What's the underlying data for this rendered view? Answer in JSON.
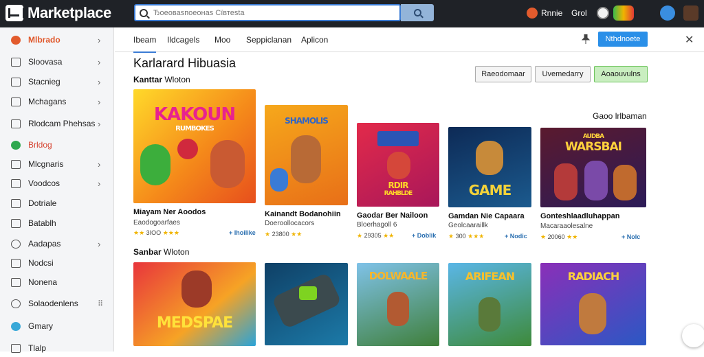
{
  "app": {
    "title": "Marketplace"
  },
  "search": {
    "placeholder": "Ђоеоваsпоеонаs Сївтеsta"
  },
  "topbar": {
    "user_name": "Rnnie",
    "mode": "Grol"
  },
  "sidebar": {
    "items": [
      {
        "label": "Mlbrado",
        "icon": "flame-icon",
        "chevron": true
      },
      {
        "label": "Sloovasa",
        "icon": "card-icon",
        "chevron": true
      },
      {
        "label": "Stacnieg",
        "icon": "grid-icon",
        "chevron": true
      },
      {
        "label": "Mchagans",
        "icon": "list-icon",
        "chevron": true
      },
      {
        "label": "Rlodcam Phehsas",
        "icon": "folder-icon",
        "chevron": true
      },
      {
        "label": "Brldog",
        "icon": "leaf-icon",
        "chevron": false
      },
      {
        "label": "Mlcgnaris",
        "icon": "table-icon",
        "chevron": true
      },
      {
        "label": "Voodcos",
        "icon": "tray-icon",
        "chevron": true
      },
      {
        "label": "Dotriale",
        "icon": "edit-icon",
        "chevron": false
      },
      {
        "label": "Batablh",
        "icon": "calendar-icon",
        "chevron": false
      },
      {
        "label": "Aadapas",
        "icon": "clock-icon",
        "chevron": true
      },
      {
        "label": "Nodcsi",
        "icon": "box-icon",
        "chevron": false
      },
      {
        "label": "Nonena",
        "icon": "image-icon",
        "chevron": false
      },
      {
        "label": "Solaodenlens",
        "icon": "settings-icon",
        "chevron": false
      },
      {
        "label": "Gmary",
        "icon": "globe-icon",
        "chevron": false
      },
      {
        "label": "Tlalp",
        "icon": "help-icon",
        "chevron": false
      }
    ]
  },
  "tabs": [
    {
      "label": "Ibeam",
      "active": true
    },
    {
      "label": "Ildcagels",
      "active": false
    },
    {
      "label": "Moo",
      "active": false
    },
    {
      "label": "Seppiclanan",
      "active": false
    },
    {
      "label": "Aplicon",
      "active": false
    }
  ],
  "toolbar": {
    "upgrade_label": "Nthdnoete"
  },
  "main": {
    "title": "Karlarard Hibuasia",
    "featured_heading_bold": "Kanttar",
    "featured_heading_rest": "Wloton",
    "filters": [
      "Raeodomaar",
      "Uvemedarry",
      "Aoaouvulns"
    ],
    "sort_label": "Gaoo lrlbaman",
    "second_heading_bold": "Sanbar",
    "second_heading_rest": "Wloton"
  },
  "featured_cards": [
    {
      "title": "Miayam Ner Aoodos",
      "sub": "Eaodogoarfaes",
      "rating": "3ІОО",
      "tag": "+ Ihoilike",
      "art": "KAKOUN",
      "art_sub": "RUMBOKES"
    },
    {
      "title": "Kainandt Bodanohiin",
      "sub": "Doeroollocacors",
      "rating": "23800",
      "tag": "",
      "art": "SHAMOLIS",
      "art_sub": ""
    },
    {
      "title": "Gaodar Ber Nailoon",
      "sub": "Bloerhagoll 6",
      "rating": "29305",
      "tag": "+ Doblik",
      "art": "RDIR",
      "art_sub": "RAHBLDE"
    },
    {
      "title": "Gamdan Nie Capaara",
      "sub": "Geolcaaraillk",
      "rating": "300",
      "tag": "+ Nodic",
      "art": "GAME",
      "art_sub": ""
    },
    {
      "title": "Gonteshlaadluhappan",
      "sub": "Macaraaolesalne",
      "rating": "20060",
      "tag": "+ Nolc",
      "art": "WARSBAI",
      "art_sub": "AUDBA"
    }
  ],
  "second_row_cards": [
    {
      "art": "MEDSPAE"
    },
    {
      "art": ""
    },
    {
      "art": "DOLWAALE"
    },
    {
      "art": "ARIFEAN"
    },
    {
      "art": "RADIACH"
    }
  ]
}
